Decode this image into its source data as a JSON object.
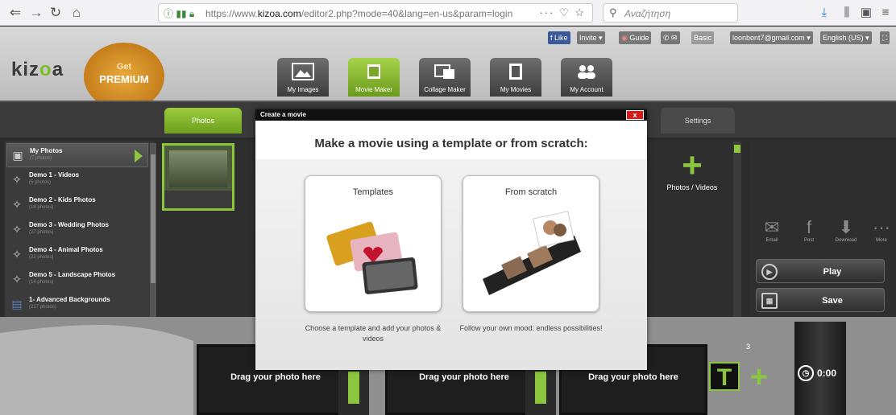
{
  "browser": {
    "url_prefix": "https://www.",
    "url_domain": "kizoa.com",
    "url_path": "/editor2.php?mode=40&lang=en-us&param=login",
    "url_actions": "··· ♡ ☆",
    "search_placeholder": "Αναζήτηση"
  },
  "app": {
    "logo_main": "kiz",
    "logo_accent": "o",
    "logo_end": "a",
    "premium_get": "Get",
    "premium_label": "PREMIUM",
    "top_links": {
      "like": "Like",
      "invite": "Invite",
      "guide": "Guide",
      "basic": "Basic",
      "email": "loonbont7@gmail.com",
      "language": "English (US)"
    },
    "nav_tabs": [
      {
        "label": "My Images"
      },
      {
        "label": "Movie Maker"
      },
      {
        "label": "Collage Maker"
      },
      {
        "label": "My Movies"
      },
      {
        "label": "My Account"
      }
    ],
    "sub_tabs": {
      "photos": "Photos",
      "settings": "Settings"
    },
    "albums": [
      {
        "title": "My Photos",
        "count": "(7 photos)"
      },
      {
        "title": "Demo 1 - Videos",
        "count": "(5 photos)"
      },
      {
        "title": "Demo 2 - Kids Photos",
        "count": "(18 photos)"
      },
      {
        "title": "Demo 3 - Wedding Photos",
        "count": "(27 photos)"
      },
      {
        "title": "Demo 4 - Animal Photos",
        "count": "(22 photos)"
      },
      {
        "title": "Demo 5 - Landscape Photos",
        "count": "(14 photos)"
      },
      {
        "title": "1- Advanced Backgrounds",
        "count": "(217 photos)"
      }
    ],
    "add_media_label": "Photos / Videos",
    "share": {
      "email": "Email",
      "post": "Post",
      "download": "Download",
      "more": "More"
    },
    "play_label": "Play",
    "save_label": "Save",
    "timeline": {
      "slot_text": "Drag your photo here",
      "counter": "3",
      "time": "0:00",
      "text_tool": "T"
    }
  },
  "modal": {
    "header": "Create a movie",
    "close": "x",
    "title": "Make a movie using a template or from scratch:",
    "templates_title": "Templates",
    "templates_desc": "Choose a template and add your photos & videos",
    "scratch_title": "From scratch",
    "scratch_desc": "Follow your own mood: endless possibilities!"
  }
}
